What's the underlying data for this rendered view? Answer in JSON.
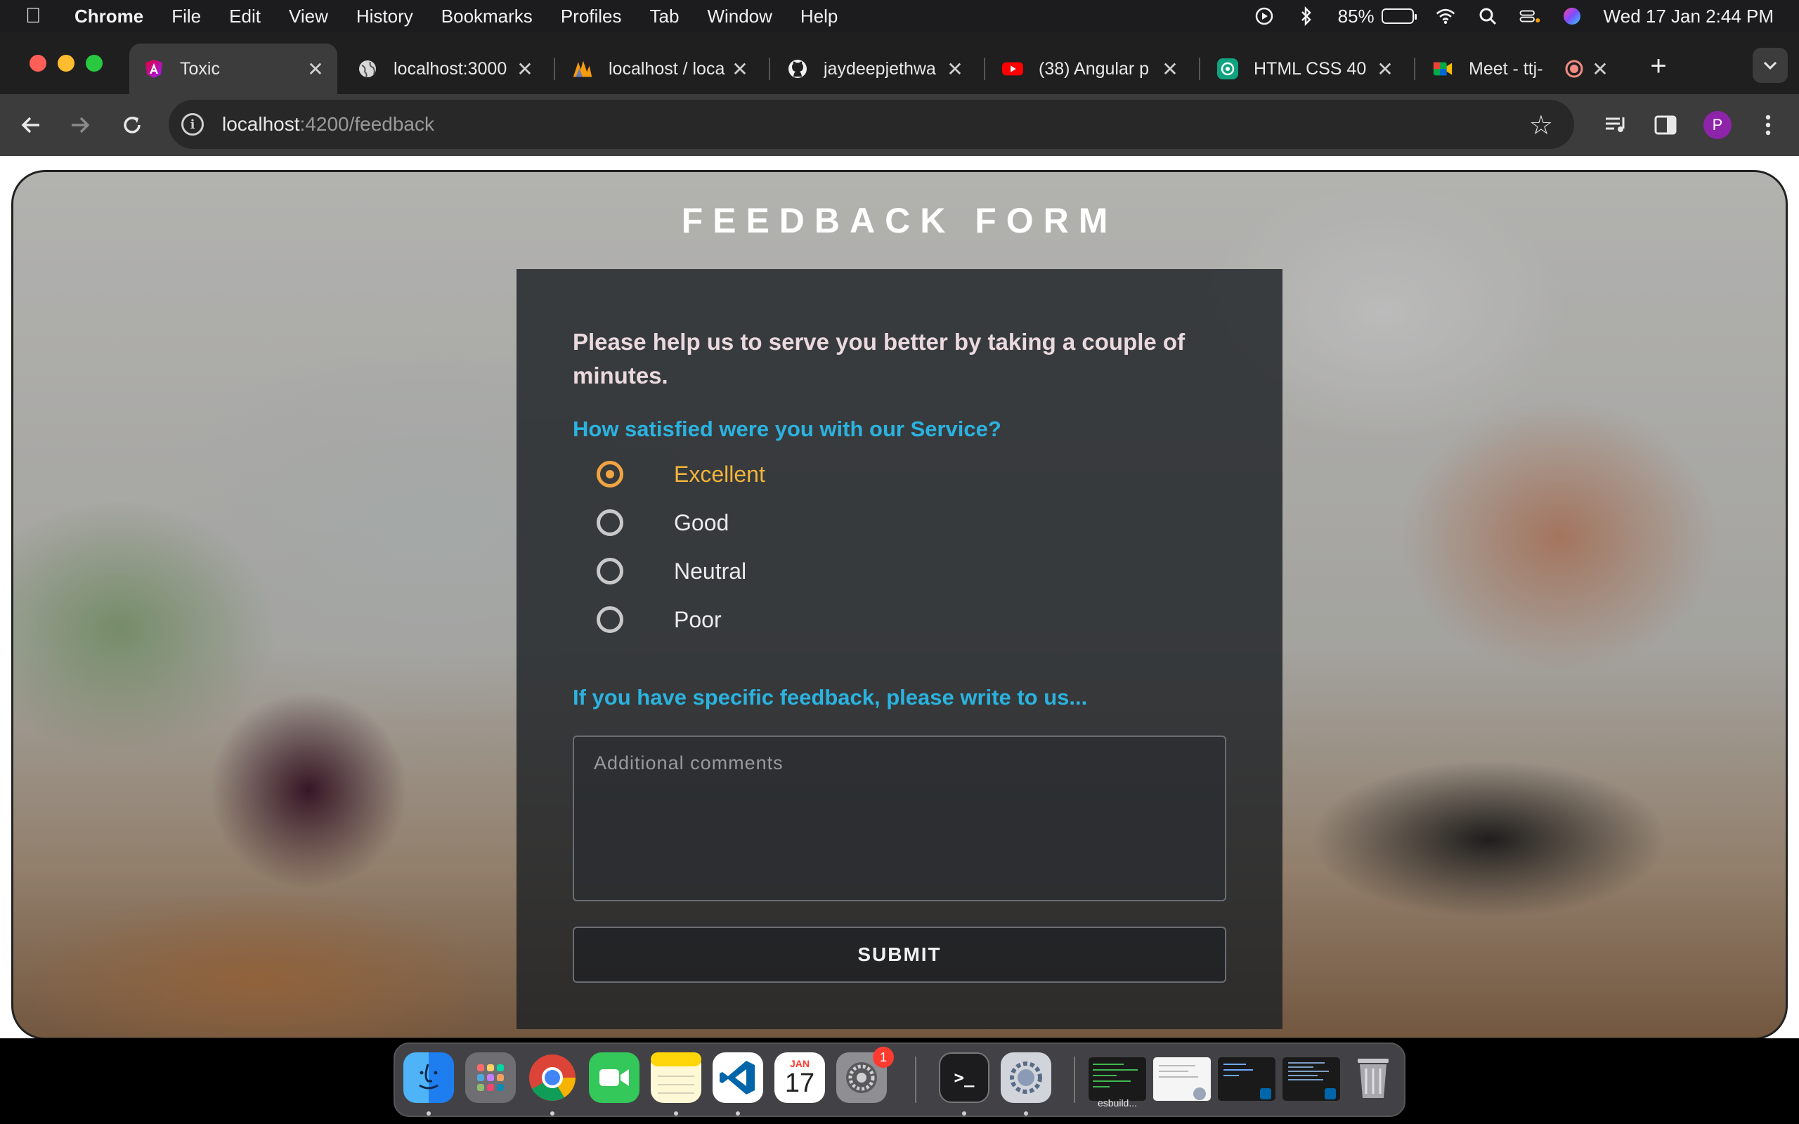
{
  "menubar": {
    "app_name": "Chrome",
    "items": [
      "File",
      "Edit",
      "View",
      "History",
      "Bookmarks",
      "Profiles",
      "Tab",
      "Window",
      "Help"
    ],
    "battery_percent": "85%",
    "battery_level": 0.85,
    "datetime": "Wed 17 Jan  2:44 PM"
  },
  "tabs": [
    {
      "title": "Toxic",
      "favicon": "angular-icon",
      "active": true
    },
    {
      "title": "localhost:3000",
      "favicon": "globe-icon",
      "active": false
    },
    {
      "title": "localhost / loca",
      "favicon": "phpmyadmin-icon",
      "active": false
    },
    {
      "title": "jaydeepjethwa",
      "favicon": "github-icon",
      "active": false
    },
    {
      "title": "(38) Angular p",
      "favicon": "youtube-icon",
      "active": false
    },
    {
      "title": "HTML CSS 40",
      "favicon": "chatgpt-icon",
      "active": false
    },
    {
      "title": "Meet - ttj-",
      "favicon": "meet-icon",
      "active": false
    }
  ],
  "address_bar": {
    "host": "localhost",
    "path": ":4200/feedback"
  },
  "profile_initial": "P",
  "form": {
    "title": "FEEDBACK FORM",
    "intro": "Please help us to serve you better by taking a couple of minutes.",
    "question": "How satisfied were you with our Service?",
    "options": [
      "Excellent",
      "Good",
      "Neutral",
      "Poor"
    ],
    "selected_option": "Excellent",
    "feedback_prompt": "If you have specific feedback, please write to us...",
    "comments_placeholder": "Additional comments",
    "comments_value": "",
    "submit_label": "SUBMIT"
  },
  "dock": {
    "calendar_month": "JAN",
    "calendar_day": "17",
    "settings_badge": "1",
    "window_thumb_label": "esbuild..."
  },
  "colors": {
    "accent_selected": "#f1a442",
    "question_text": "#2bb3e0",
    "intro_text": "#ead9dd"
  }
}
